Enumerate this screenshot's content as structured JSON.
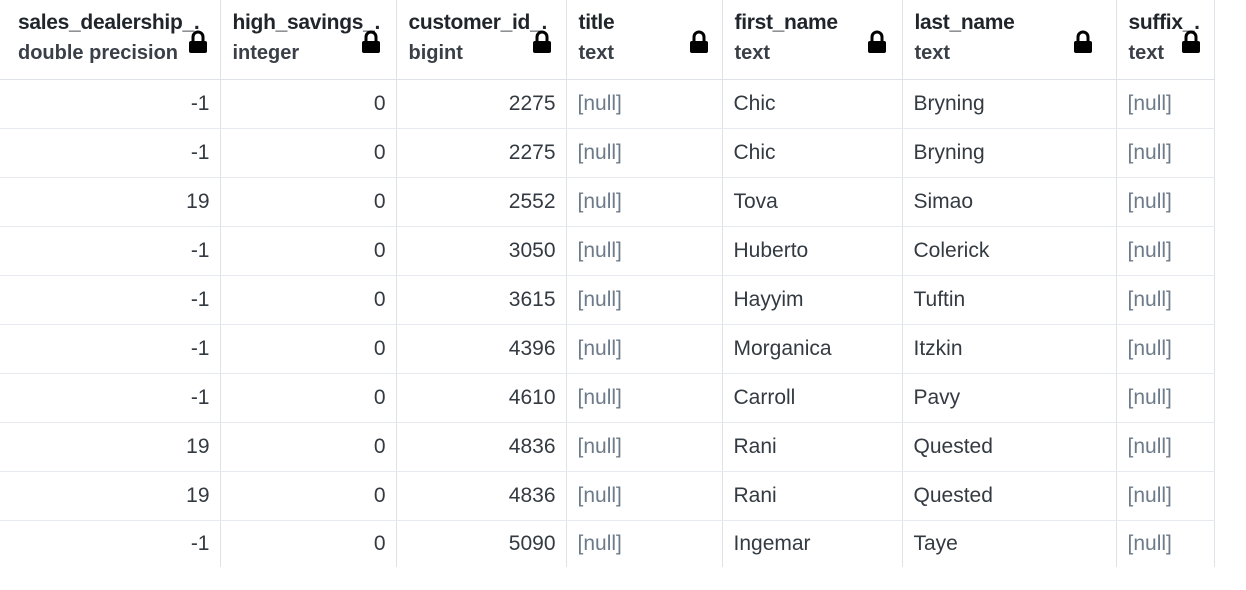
{
  "columns": [
    {
      "name": "sales_dealership_.",
      "type": "double precision",
      "align": "num"
    },
    {
      "name": "high_savings_.",
      "type": "integer",
      "align": "num"
    },
    {
      "name": "customer_id_.",
      "type": "bigint",
      "align": "num"
    },
    {
      "name": "title",
      "type": "text",
      "align": "txt"
    },
    {
      "name": "first_name",
      "type": "text",
      "align": "txt"
    },
    {
      "name": "last_name",
      "type": "text",
      "align": "txt"
    },
    {
      "name": "suffix_.",
      "type": "text",
      "align": "txt"
    }
  ],
  "lock_icon": "lock-icon",
  "rows": [
    [
      "-1",
      "0",
      "2275",
      "[null]",
      "Chic",
      "Bryning",
      "[null]"
    ],
    [
      "-1",
      "0",
      "2275",
      "[null]",
      "Chic",
      "Bryning",
      "[null]"
    ],
    [
      "19",
      "0",
      "2552",
      "[null]",
      "Tova",
      "Simao",
      "[null]"
    ],
    [
      "-1",
      "0",
      "3050",
      "[null]",
      "Huberto",
      "Colerick",
      "[null]"
    ],
    [
      "-1",
      "0",
      "3615",
      "[null]",
      "Hayyim",
      "Tuftin",
      "[null]"
    ],
    [
      "-1",
      "0",
      "4396",
      "[null]",
      "Morganica",
      "Itzkin",
      "[null]"
    ],
    [
      "-1",
      "0",
      "4610",
      "[null]",
      "Carroll",
      "Pavy",
      "[null]"
    ],
    [
      "19",
      "0",
      "4836",
      "[null]",
      "Rani",
      "Quested",
      "[null]"
    ],
    [
      "19",
      "0",
      "4836",
      "[null]",
      "Rani",
      "Quested",
      "[null]"
    ],
    [
      "-1",
      "0",
      "5090",
      "[null]",
      "Ingemar",
      "Taye",
      "[null]"
    ]
  ],
  "null_text": "[null]"
}
